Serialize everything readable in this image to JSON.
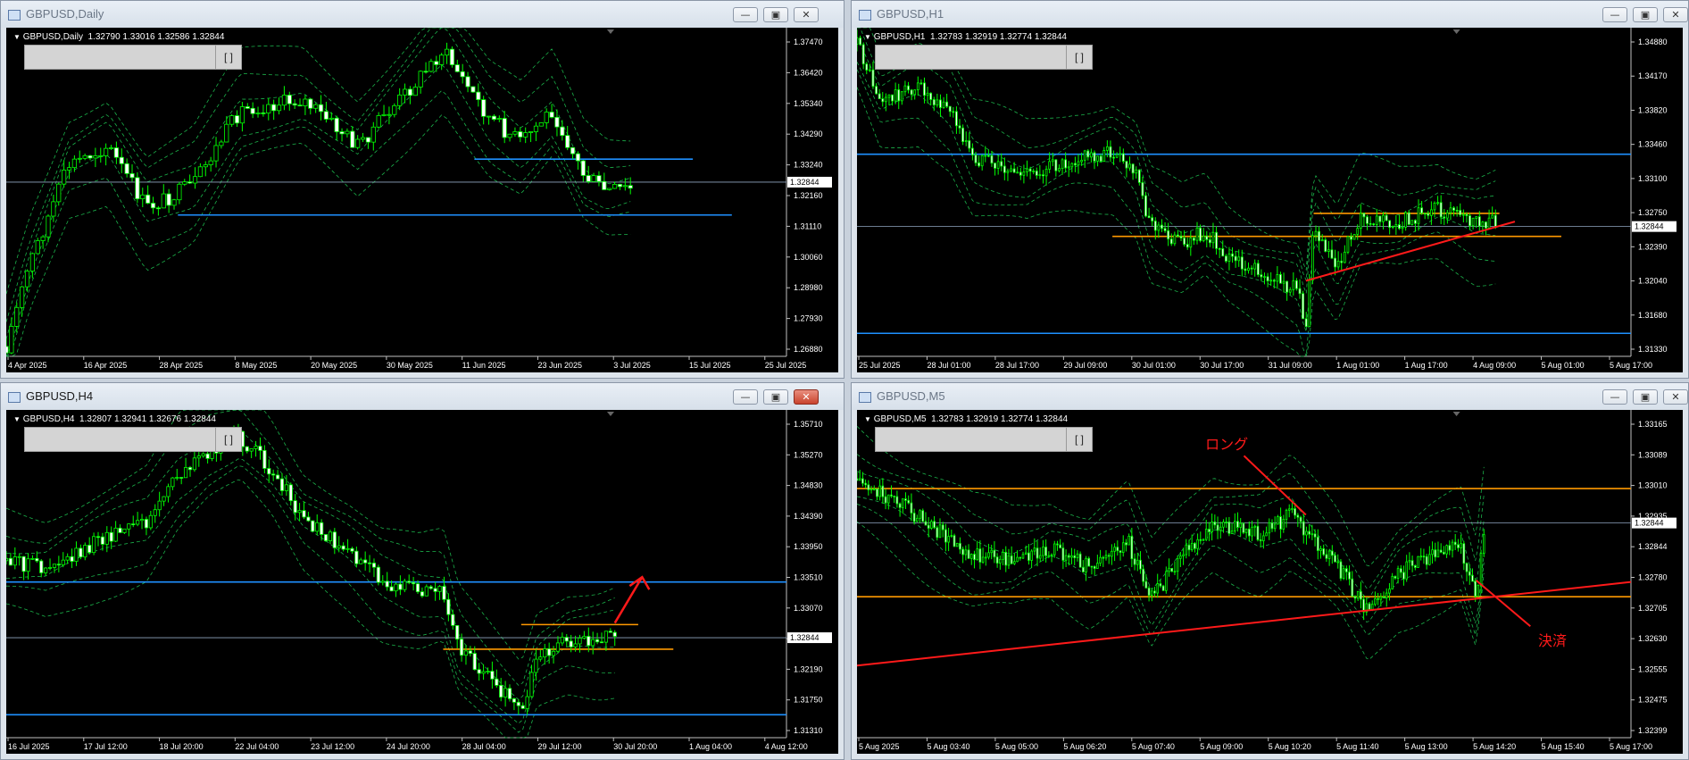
{
  "colors": {
    "bull": "#00ff00",
    "bear": "#ffffff",
    "band": "#1bb24a",
    "blue_line": "#1e90ff",
    "orange_line": "#ff9900",
    "red_line": "#ff1a1a",
    "price_tag": "#ffffff"
  },
  "windows": [
    {
      "title": "GBPUSD,Daily",
      "ohlc": "GBPUSD,Daily  1.32790 1.33016 1.32586 1.32844",
      "y_ticks": [
        "1.37470",
        "1.36420",
        "1.35340",
        "1.34290",
        "1.33240",
        "1.32160",
        "1.31110",
        "1.30060",
        "1.28980",
        "1.27930",
        "1.26880"
      ],
      "price_tag": "1.32844",
      "x_ticks": [
        "4 Apr 2025",
        "16 Apr 2025",
        "28 Apr 2025",
        "8 May 2025",
        "20 May 2025",
        "30 May 2025",
        "11 Jun 2025",
        "23 Jun 2025",
        "3 Jul 2025",
        "15 Jul 2025",
        "25 Jul 2025"
      ],
      "annotations": [],
      "input_button": "[ ]",
      "close_active": false
    },
    {
      "title": "GBPUSD,H1",
      "ohlc": "GBPUSD,H1  1.32783 1.32919 1.32774 1.32844",
      "y_ticks": [
        "1.34880",
        "1.34170",
        "1.33820",
        "1.33460",
        "1.33100",
        "1.32750",
        "1.32390",
        "1.32040",
        "1.31680",
        "1.31330"
      ],
      "price_tag": "1.32844",
      "x_ticks": [
        "25 Jul 2025",
        "28 Jul 01:00",
        "28 Jul 17:00",
        "29 Jul 09:00",
        "30 Jul 01:00",
        "30 Jul 17:00",
        "31 Jul 09:00",
        "1 Aug 01:00",
        "1 Aug 17:00",
        "4 Aug 09:00",
        "5 Aug 01:00",
        "5 Aug 17:00"
      ],
      "annotations": [],
      "input_button": "[ ]",
      "close_active": false
    },
    {
      "title": "GBPUSD,H4",
      "ohlc": "GBPUSD,H4  1.32807 1.32941 1.32676 1.32844",
      "y_ticks": [
        "1.35710",
        "1.35270",
        "1.34830",
        "1.34390",
        "1.33950",
        "1.33510",
        "1.33070",
        "1.32630",
        "1.32190",
        "1.31750",
        "1.31310"
      ],
      "price_tag": "1.32844",
      "x_ticks": [
        "16 Jul 2025",
        "17 Jul 12:00",
        "18 Jul 20:00",
        "22 Jul 04:00",
        "23 Jul 12:00",
        "24 Jul 20:00",
        "28 Jul 04:00",
        "29 Jul 12:00",
        "30 Jul 20:00",
        "1 Aug 04:00",
        "4 Aug 12:00"
      ],
      "annotations": [],
      "input_button": "[ ]",
      "close_active": true
    },
    {
      "title": "GBPUSD,M5",
      "ohlc": "GBPUSD,M5  1.32783 1.32919 1.32774 1.32844",
      "y_ticks": [
        "1.33165",
        "1.33089",
        "1.33010",
        "1.32935",
        "1.32844",
        "1.32780",
        "1.32705",
        "1.32630",
        "1.32555",
        "1.32475",
        "1.32399"
      ],
      "price_tag": "1.32844",
      "x_ticks": [
        "5 Aug 2025",
        "5 Aug 03:40",
        "5 Aug 05:00",
        "5 Aug 06:20",
        "5 Aug 07:40",
        "5 Aug 09:00",
        "5 Aug 10:20",
        "5 Aug 11:40",
        "5 Aug 13:00",
        "5 Aug 14:20",
        "5 Aug 15:40",
        "5 Aug 17:00"
      ],
      "annotations": [
        "ロング",
        "決済"
      ],
      "input_button": "[ ]",
      "close_active": false
    }
  ]
}
